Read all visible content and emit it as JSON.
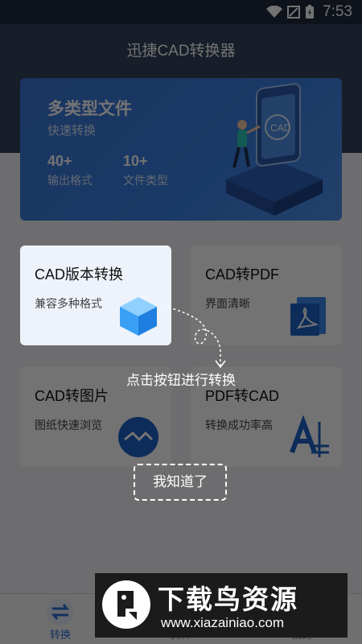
{
  "status_bar": {
    "time": "7:53"
  },
  "app": {
    "title": "迅捷CAD转换器"
  },
  "banner": {
    "title": "多类型文件",
    "subtitle": "快速转换",
    "stats": [
      {
        "number": "40+",
        "label": "输出格式"
      },
      {
        "number": "10+",
        "label": "文件类型"
      }
    ],
    "screen_text": "CAD"
  },
  "cards": [
    {
      "title": "CAD版本转换",
      "subtitle": "兼容多种格式",
      "icon": "cube-icon"
    },
    {
      "title": "CAD转PDF",
      "subtitle": "界面清晰",
      "icon": "pdf-icon"
    },
    {
      "title": "CAD转图片",
      "subtitle": "图纸快速浏览",
      "icon": "image-wave-icon"
    },
    {
      "title": "PDF转CAD",
      "subtitle": "转换成功率高",
      "icon": "cad-letter-icon"
    }
  ],
  "guide": {
    "tip": "点击按钮进行转换",
    "button": "我知道了"
  },
  "bottom_nav": {
    "items": [
      {
        "label": "转换",
        "icon": "convert-icon"
      },
      {
        "label": "文件",
        "icon": "file-icon"
      },
      {
        "label": "我的",
        "icon": "person-icon"
      }
    ]
  },
  "watermark": {
    "title": "下载鸟资源",
    "url": "www.xiazainiao.com"
  },
  "colors": {
    "header": "#33435b",
    "banner": "#3a7fe3",
    "accent": "#2b6fd6"
  }
}
